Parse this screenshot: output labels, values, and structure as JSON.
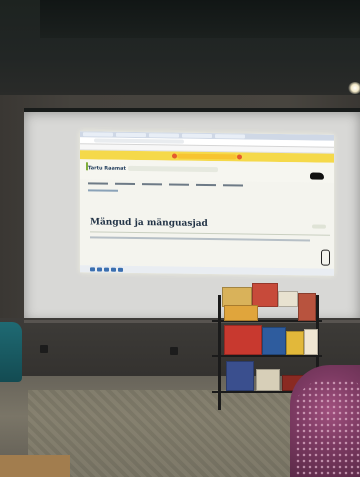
{
  "projected_page": {
    "site_name": "Tartu Raamat",
    "title": "Mängud ja mänguasjad"
  },
  "colors": {
    "banner": "#f5d94a",
    "title_text": "#233447",
    "logo_accent": "#7fae3a",
    "cart_frame": "#1b1b1b"
  }
}
